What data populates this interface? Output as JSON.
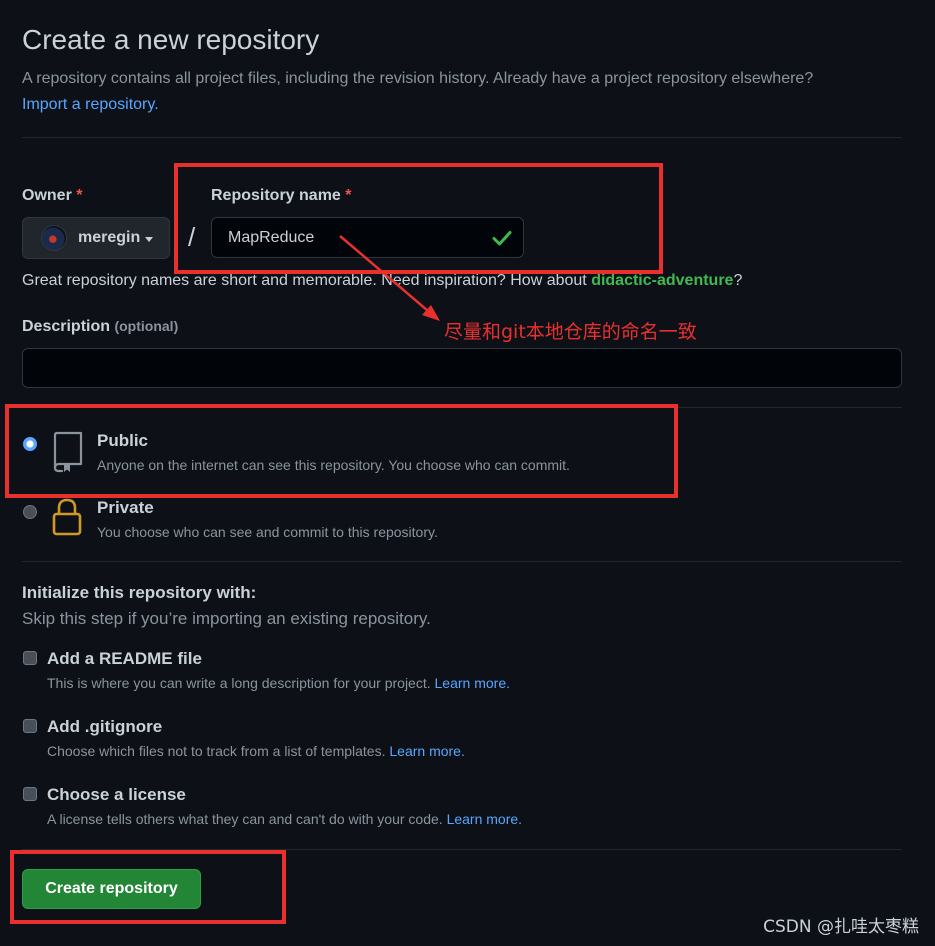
{
  "header": {
    "title": "Create a new repository",
    "subtitle": "A repository contains all project files, including the revision history. Already have a project repository elsewhere?",
    "import_link": "Import a repository."
  },
  "owner": {
    "label": "Owner",
    "required_marker": "*",
    "selected": "meregin"
  },
  "separator": "/",
  "repo_name": {
    "label": "Repository name",
    "required_marker": "*",
    "value": "MapReduce",
    "hint_prefix": "Great repository names are short and memorable. Need inspiration? How about ",
    "suggestion": "didactic-adventure",
    "hint_suffix": "?"
  },
  "annotation": {
    "text": "尽量和git本地仓库的命名一致",
    "color": "#e8302e"
  },
  "description": {
    "label": "Description",
    "optional": "(optional)",
    "value": ""
  },
  "visibility": {
    "selected": "public",
    "public": {
      "title": "Public",
      "desc": "Anyone on the internet can see this repository. You choose who can commit.",
      "icon": "repo-icon"
    },
    "private": {
      "title": "Private",
      "desc": "You choose who can see and commit to this repository.",
      "icon": "lock-icon"
    }
  },
  "initialize": {
    "title": "Initialize this repository with:",
    "subtitle": "Skip this step if you’re importing an existing repository.",
    "options": [
      {
        "title": "Add a README file",
        "desc": "This is where you can write a long description for your project.",
        "link": "Learn more.",
        "checked": false
      },
      {
        "title": "Add .gitignore",
        "desc": "Choose which files not to track from a list of templates.",
        "link": "Learn more.",
        "checked": false
      },
      {
        "title": "Choose a license",
        "desc": "A license tells others what they can and can't do with your code.",
        "link": "Learn more.",
        "checked": false
      }
    ]
  },
  "create_button": "Create repository",
  "watermark": "CSDN @扎哇太枣糕",
  "colors": {
    "background": "#0d1117",
    "link": "#58a6ff",
    "success": "#3fb950",
    "button": "#238636",
    "required": "#f85149"
  }
}
